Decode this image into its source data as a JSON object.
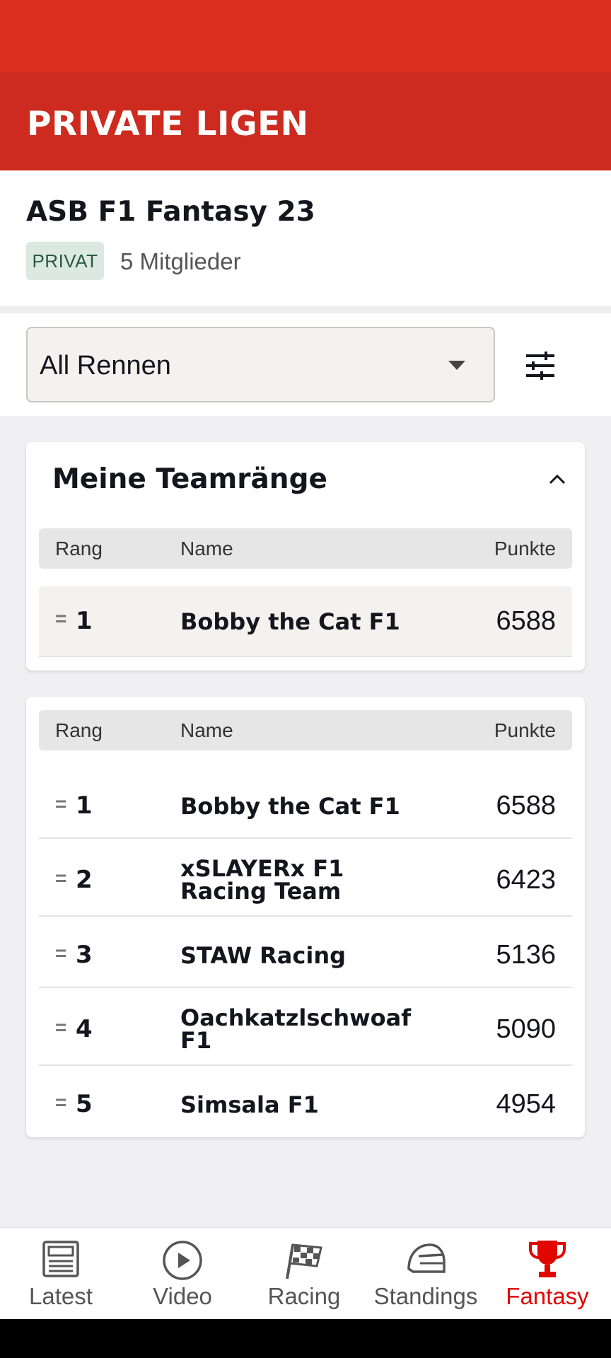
{
  "header": {
    "title": "PRIVATE LIGEN"
  },
  "league": {
    "name": "ASB F1 Fantasy 23",
    "badge": "PRIVAT",
    "members": "5 Mitglieder"
  },
  "filter": {
    "selected": "All Rennen",
    "filter_icon": "sliders-icon",
    "dropdown_icon": "caret-down-icon"
  },
  "my_ranks": {
    "title": "Meine Teamränge",
    "columns": {
      "rank": "Rang",
      "name": "Name",
      "points": "Punkte"
    },
    "rows": [
      {
        "change": "=",
        "rank": "1",
        "name": "Bobby the Cat F1",
        "points": "6588"
      }
    ]
  },
  "league_table": {
    "columns": {
      "rank": "Rang",
      "name": "Name",
      "points": "Punkte"
    },
    "rows": [
      {
        "change": "=",
        "rank": "1",
        "name": "Bobby the Cat F1",
        "points": "6588"
      },
      {
        "change": "=",
        "rank": "2",
        "name": "xSLAYERx F1 Racing Team",
        "points": "6423"
      },
      {
        "change": "=",
        "rank": "3",
        "name": "STAW Racing",
        "points": "5136"
      },
      {
        "change": "=",
        "rank": "4",
        "name": "Oachkatzlschwoaf F1",
        "points": "5090"
      },
      {
        "change": "=",
        "rank": "5",
        "name": "Simsala F1",
        "points": "4954"
      }
    ]
  },
  "nav": {
    "items": [
      {
        "label": "Latest",
        "icon": "newspaper-icon"
      },
      {
        "label": "Video",
        "icon": "play-icon"
      },
      {
        "label": "Racing",
        "icon": "checkered-flag-icon"
      },
      {
        "label": "Standings",
        "icon": "helmet-icon"
      },
      {
        "label": "Fantasy",
        "icon": "trophy-icon"
      }
    ],
    "active": "Fantasy",
    "active_color": "#e10600"
  },
  "colors": {
    "brand_red": "#dc2f21",
    "header_red": "#cd2b1f"
  }
}
